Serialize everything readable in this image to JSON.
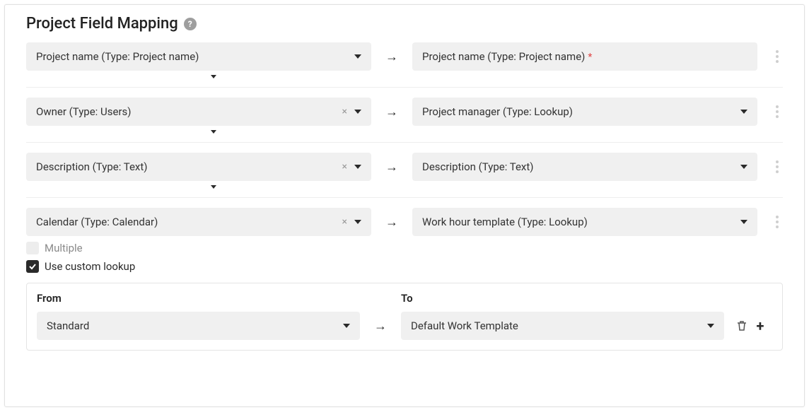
{
  "title": "Project Field Mapping",
  "help_tooltip": "?",
  "rows": [
    {
      "left": {
        "label": "Project name (Type: Project name)",
        "clearable": false
      },
      "right": {
        "label": "Project name (Type: Project name)",
        "required": true,
        "has_caret": false
      },
      "has_below_caret": true,
      "has_dots": true
    },
    {
      "left": {
        "label": "Owner (Type: Users)",
        "clearable": true
      },
      "right": {
        "label": "Project manager (Type: Lookup)",
        "required": false,
        "has_caret": true
      },
      "has_below_caret": true,
      "has_dots": true
    },
    {
      "left": {
        "label": "Description (Type: Text)",
        "clearable": true
      },
      "right": {
        "label": "Description (Type: Text)",
        "required": false,
        "has_caret": true
      },
      "has_below_caret": true,
      "has_dots": true
    },
    {
      "left": {
        "label": "Calendar (Type: Calendar)",
        "clearable": true
      },
      "right": {
        "label": "Work hour template (Type: Lookup)",
        "required": false,
        "has_caret": true
      },
      "has_below_caret": false,
      "has_dots": true
    }
  ],
  "multiple": {
    "label": "Multiple",
    "checked": false
  },
  "custom_lookup": {
    "label": "Use custom lookup",
    "checked": true
  },
  "lookup": {
    "from_header": "From",
    "to_header": "To",
    "rows": [
      {
        "from": "Standard",
        "to": "Default Work Template"
      }
    ]
  }
}
